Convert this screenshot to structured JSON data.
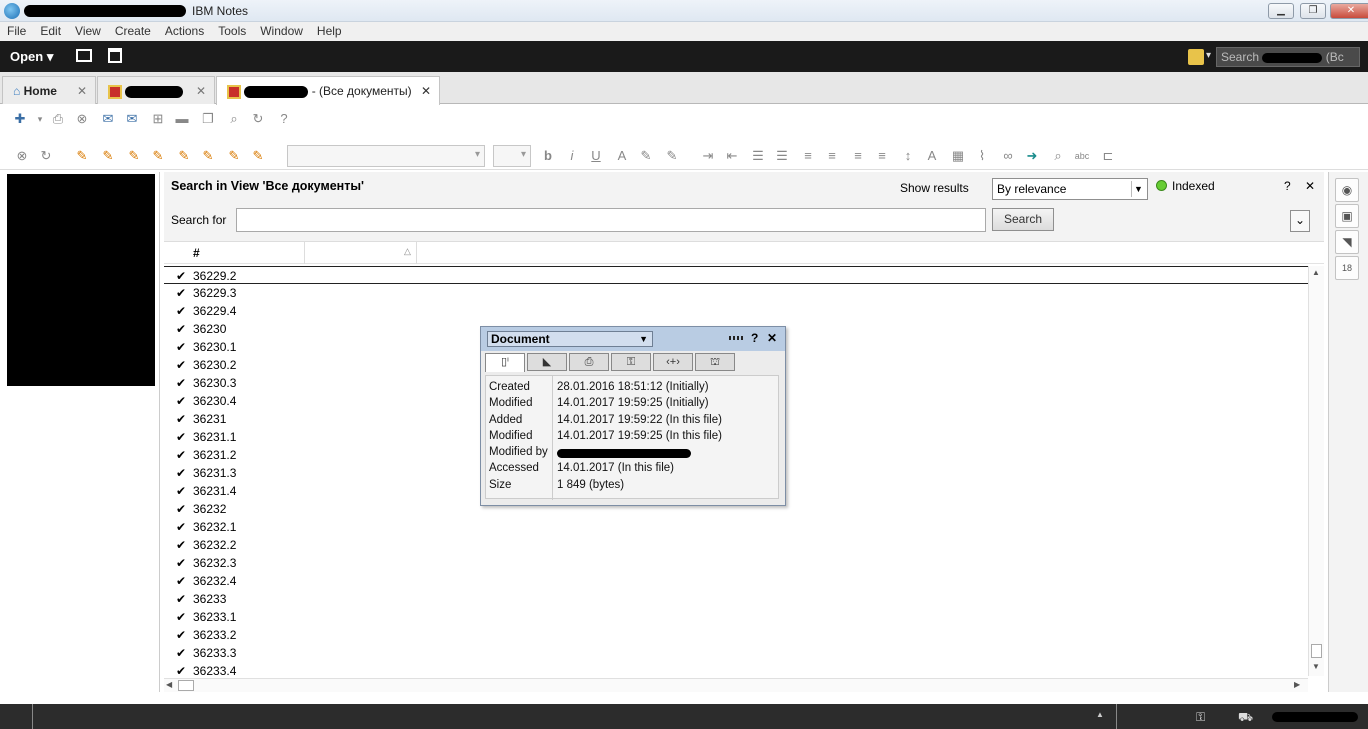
{
  "window": {
    "title": "IBM Notes",
    "minimize_label": "▁",
    "restore_label": "❐",
    "close_label": "✕"
  },
  "menu": [
    "File",
    "Edit",
    "View",
    "Create",
    "Actions",
    "Tools",
    "Window",
    "Help"
  ],
  "darkbar": {
    "open_label": "Open",
    "search_placeholder": "Search",
    "search_suffix": "(Bc"
  },
  "tabs": [
    {
      "label": "Home",
      "icon": "home-icon",
      "close": "✕"
    },
    {
      "label": "",
      "icon": "database-icon",
      "close": "✕"
    },
    {
      "label": "- (Все документы)",
      "icon": "database-icon",
      "close": "✕"
    }
  ],
  "search": {
    "title": "Search in View 'Все документы'",
    "show_results_label": "Show results",
    "results_value": "By relevance",
    "indexed_label": "Indexed",
    "search_for_label": "Search for",
    "search_input_value": "",
    "search_button": "Search",
    "help": "?",
    "close": "✕",
    "expand": "⌄"
  },
  "view": {
    "column_header": "#",
    "rows": [
      "36229.2",
      "36229.3",
      "36229.4",
      "36230",
      "36230.1",
      "36230.2",
      "36230.3",
      "36230.4",
      "36231",
      "36231.1",
      "36231.2",
      "36231.3",
      "36231.4",
      "36232",
      "36232.1",
      "36232.2",
      "36232.3",
      "36232.4",
      "36233",
      "36233.1",
      "36233.2",
      "36233.3",
      "36233.4"
    ]
  },
  "docprops": {
    "select_value": "Document",
    "help": "?",
    "close": "✕",
    "fields": [
      {
        "k": "Created",
        "v": "28.01.2016 18:51:12 (Initially)"
      },
      {
        "k": "Modified",
        "v": "14.01.2017 19:59:25 (Initially)"
      },
      {
        "k": "Added",
        "v": "14.01.2017 19:59:22 (In this file)"
      },
      {
        "k": "Modified",
        "v": "14.01.2017 19:59:25 (In this file)"
      },
      {
        "k": "Modified by",
        "v": ""
      },
      {
        "k": "Accessed",
        "v": "14.01.2017 (In this file)"
      },
      {
        "k": "Size",
        "v": "1 849 (bytes)"
      }
    ]
  },
  "colors": {
    "dark_bar": "#1a1a1a",
    "accent": "#3a6ea5",
    "indexed": "#66cc33",
    "status_bar": "#2c2c2c"
  }
}
